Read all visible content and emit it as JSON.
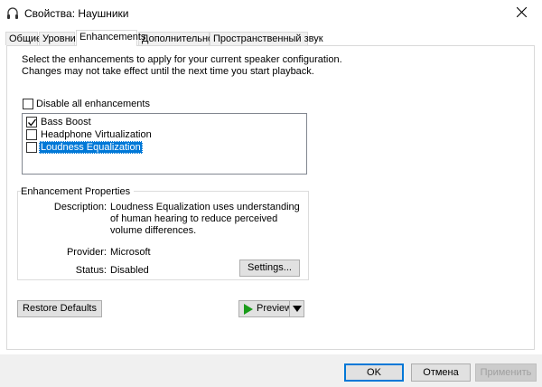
{
  "window": {
    "title": "Свойства: Наушники",
    "icon": "headphones-icon",
    "close_icon": "close-icon"
  },
  "tabs": [
    {
      "label": "Общие",
      "active": false
    },
    {
      "label": "Уровни",
      "active": false
    },
    {
      "label": "Enhancements",
      "active": true
    },
    {
      "label": "Дополнительно",
      "active": false
    },
    {
      "label": "Пространственный звук",
      "active": false
    }
  ],
  "enhancements": {
    "description": "Select the enhancements to apply for your current speaker configuration. Changes may not take effect until the next time you start playback.",
    "disable_all": {
      "label": "Disable all enhancements",
      "checked": false
    },
    "items": [
      {
        "label": "Bass Boost",
        "checked": true,
        "selected": false
      },
      {
        "label": "Headphone Virtualization",
        "checked": false,
        "selected": false
      },
      {
        "label": "Loudness Equalization",
        "checked": false,
        "selected": true
      }
    ]
  },
  "properties": {
    "group_title": "Enhancement Properties",
    "description_label": "Description:",
    "description_value": "Loudness Equalization uses understanding of human hearing to reduce perceived volume differences.",
    "provider_label": "Provider:",
    "provider_value": "Microsoft",
    "status_label": "Status:",
    "status_value": "Disabled",
    "settings_button": "Settings..."
  },
  "buttons": {
    "restore_defaults": "Restore Defaults",
    "preview": "Preview",
    "ok": "OK",
    "cancel": "Отмена",
    "apply": "Применить"
  },
  "colors": {
    "selection": "#0078d7",
    "play_icon": "#1a9c1a"
  }
}
